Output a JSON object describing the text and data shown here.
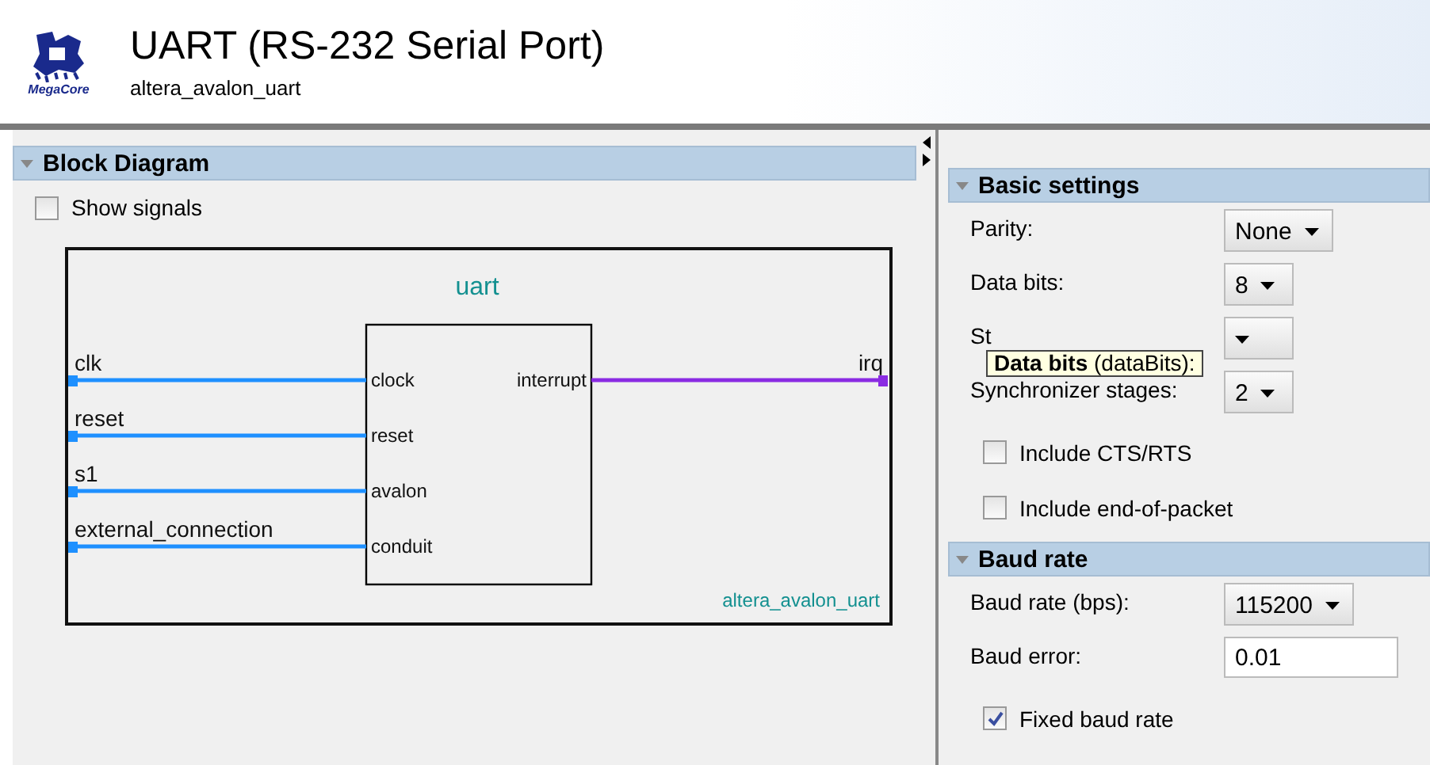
{
  "header": {
    "title": "UART (RS-232 Serial Port)",
    "subtitle": "altera_avalon_uart",
    "logo_text": "MegaCore"
  },
  "block_diagram": {
    "title": "Block Diagram",
    "expanded": true,
    "show_signals": {
      "label": "Show signals",
      "checked": false
    },
    "component": {
      "name": "uart",
      "type": "altera_avalon_uart",
      "inputs": [
        {
          "signal": "clk",
          "port": "clock"
        },
        {
          "signal": "reset",
          "port": "reset"
        },
        {
          "signal": "s1",
          "port": "avalon"
        },
        {
          "signal": "external_connection",
          "port": "conduit"
        }
      ],
      "outputs": [
        {
          "signal": "irq",
          "port": "interrupt"
        }
      ]
    }
  },
  "sections": [
    {
      "title": "Basic settings",
      "expanded": true,
      "items": [
        {
          "kind": "dropdown",
          "label": "Parity:",
          "value": "None"
        },
        {
          "kind": "dropdown",
          "label": "Data bits:",
          "value": "8"
        },
        {
          "kind": "dropdown",
          "label": "St"
        },
        {
          "kind": "dropdown",
          "label": "Synchronizer stages:",
          "value": "2"
        },
        {
          "kind": "checkbox",
          "label": "Include CTS/RTS",
          "checked": false
        },
        {
          "kind": "checkbox",
          "label": "Include end-of-packet",
          "checked": false
        }
      ]
    },
    {
      "title": "Baud rate",
      "expanded": true,
      "items": [
        {
          "kind": "dropdown",
          "label": "Baud rate (bps):",
          "value": "115200"
        },
        {
          "kind": "field",
          "label": "Baud error:",
          "value": "0.01"
        },
        {
          "kind": "checkbox",
          "label": "Fixed baud rate",
          "checked": true
        }
      ]
    }
  ],
  "tooltip": {
    "text": "**Data bits** (dataBits):"
  }
}
